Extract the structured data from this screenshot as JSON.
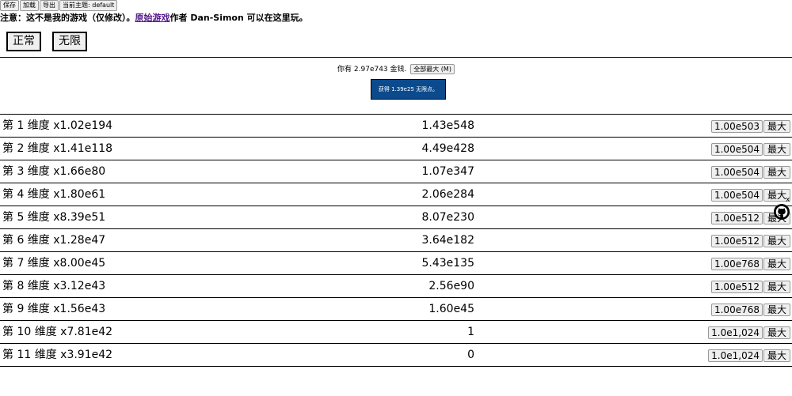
{
  "toolbar": {
    "save": "保存",
    "load": "加载",
    "export": "导出",
    "theme": "当前主题: default"
  },
  "notice": {
    "prefix": "注意：这不是我的游戏（仅修改）。",
    "link": "原始游戏",
    "suffix": "作者 Dan-Simon 可以在这里玩。"
  },
  "modes": {
    "normal": "正常",
    "infinite": "无限"
  },
  "top": {
    "money_text": "你有 2.97e743 金钱.",
    "max_all": "全部最大 (M)",
    "infinity_button": "获得 1.39e25 无限点。"
  },
  "dimensions": [
    {
      "name": "第 1 维度 x1.02e194",
      "amount": "1.43e548",
      "cost": "1.00e503",
      "max": "最大"
    },
    {
      "name": "第 2 维度 x1.41e118",
      "amount": "4.49e428",
      "cost": "1.00e504",
      "max": "最大"
    },
    {
      "name": "第 3 维度 x1.66e80",
      "amount": "1.07e347",
      "cost": "1.00e504",
      "max": "最大"
    },
    {
      "name": "第 4 维度 x1.80e61",
      "amount": "2.06e284",
      "cost": "1.00e504",
      "max": "最大"
    },
    {
      "name": "第 5 维度 x8.39e51",
      "amount": "8.07e230",
      "cost": "1.00e512",
      "max": "最大"
    },
    {
      "name": "第 6 维度 x1.28e47",
      "amount": "3.64e182",
      "cost": "1.00e512",
      "max": "最大"
    },
    {
      "name": "第 7 维度 x8.00e45",
      "amount": "5.43e135",
      "cost": "1.00e768",
      "max": "最大"
    },
    {
      "name": "第 8 维度 x3.12e43",
      "amount": "2.56e90",
      "cost": "1.00e512",
      "max": "最大"
    },
    {
      "name": "第 9 维度 x1.56e43",
      "amount": "1.60e45",
      "cost": "1.00e768",
      "max": "最大"
    },
    {
      "name": "第 10 维度 x7.81e42",
      "amount": "1",
      "cost": "1.0e1,024",
      "max": "最大"
    },
    {
      "name": "第 11 维度 x3.91e42",
      "amount": "0",
      "cost": "1.0e1,024",
      "max": "最大"
    }
  ],
  "overlay": {
    "close": "x",
    "icon": "github-icon"
  }
}
